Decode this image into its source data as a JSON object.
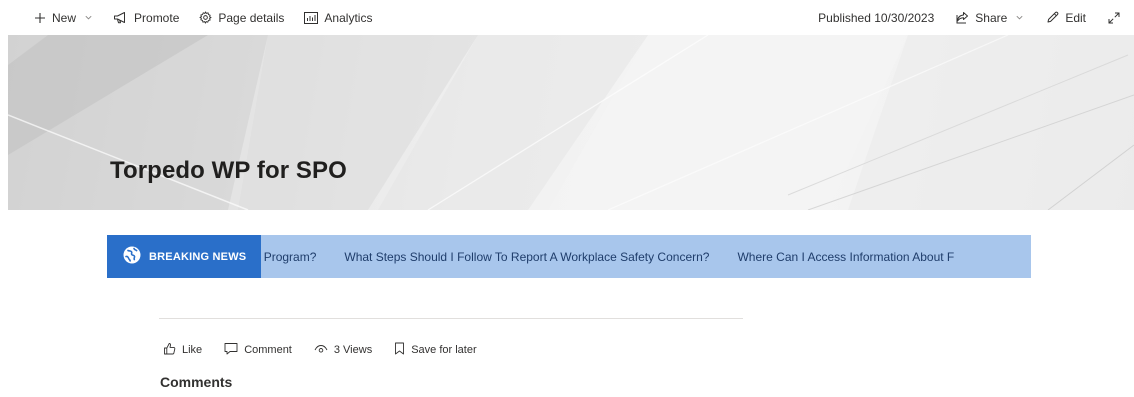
{
  "command_bar": {
    "new_label": "New",
    "promote_label": "Promote",
    "page_details_label": "Page details",
    "analytics_label": "Analytics",
    "published_text": "Published 10/30/2023",
    "share_label": "Share",
    "edit_label": "Edit"
  },
  "banner": {
    "title": "Torpedo WP for SPO"
  },
  "ticker": {
    "badge_label": "BREAKING NEWS",
    "items": [
      "ellness Program?",
      "What Steps Should I Follow To Report A Workplace Safety Concern?",
      "Where Can I Access Information About F"
    ],
    "badge_color": "#2a6fc9",
    "track_color": "#a8c6ec"
  },
  "social_bar": {
    "like_label": "Like",
    "comment_label": "Comment",
    "views_text": "3 Views",
    "save_label": "Save for later"
  },
  "comments": {
    "heading": "Comments"
  },
  "icons": {
    "new": "plus-icon",
    "promote": "megaphone-icon",
    "page_details": "gear-icon",
    "analytics": "chart-icon",
    "share": "share-icon",
    "edit": "pencil-icon",
    "expand": "expand-icon",
    "badge": "globe-icon",
    "like": "thumbs-up-icon",
    "comment": "speech-bubble-icon",
    "views": "eye-icon",
    "save": "bookmark-icon"
  }
}
